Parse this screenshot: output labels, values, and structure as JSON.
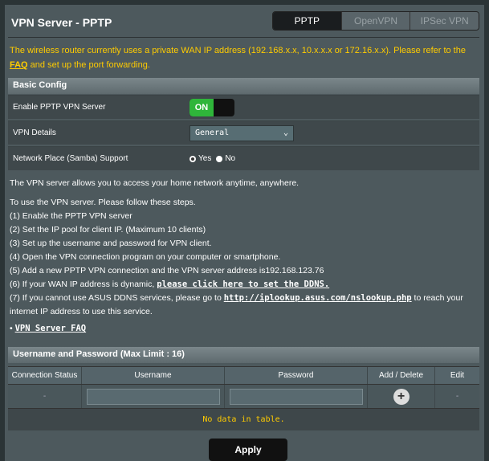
{
  "header": {
    "title": "VPN Server - PPTP"
  },
  "tabs": [
    {
      "label": "PPTP"
    },
    {
      "label": "OpenVPN"
    },
    {
      "label": "IPSec VPN"
    }
  ],
  "notice": {
    "text": "The wireless router currently uses a private WAN IP address (192.168.x.x, 10.x.x.x or 172.16.x.x). Please refer to the ",
    "link": "FAQ",
    "text2": " and set up the port forwarding."
  },
  "basic": {
    "heading": "Basic Config",
    "enable_label": "Enable PPTP VPN Server",
    "toggle_on": "ON",
    "details_label": "VPN Details",
    "details_value": "General",
    "samba_label": "Network Place (Samba) Support",
    "yes": "Yes",
    "no": "No"
  },
  "info": {
    "access": "The VPN server allows you to access your home network anytime, anywhere.",
    "steps_intro": "To use the VPN server. Please follow these steps.",
    "step1": "(1) Enable the PPTP VPN server",
    "step2": "(2) Set the IP pool for client IP. (Maximum 10 clients)",
    "step3": "(3) Set up the username and password for VPN client.",
    "step4": "(4) Open the VPN connection program on your computer or smartphone.",
    "step5": "(5) Add a new PPTP VPN connection and the VPN server address is192.168.123.76",
    "step6_pre": "(6) If your WAN IP address is dynamic, ",
    "step6_link": "please click here to set the DDNS.",
    "step7_pre": "(7) If you cannot use ASUS DDNS services, please go to ",
    "step7_link": "http://iplookup.asus.com/nslookup.php",
    "step7_post": " to reach your",
    "step7_line2": "internet IP address to use this service.",
    "faq_link": "VPN Server FAQ"
  },
  "users": {
    "heading": "Username and Password (Max Limit : 16)",
    "columns": [
      "Connection Status",
      "Username",
      "Password",
      "Add / Delete",
      "Edit"
    ],
    "row_status": "-",
    "row_edit": "-",
    "empty": "No data in table."
  },
  "apply_label": "Apply"
}
